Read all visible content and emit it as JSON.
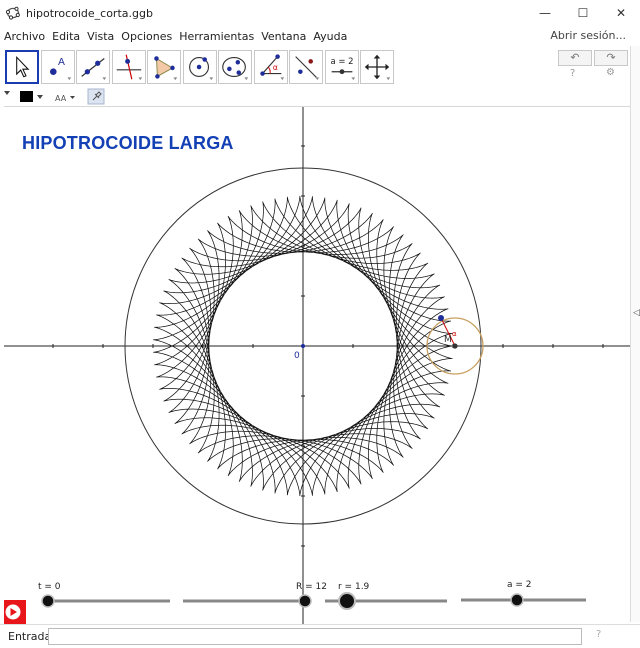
{
  "window": {
    "title": "hipotrocoide_corta.ggb",
    "minimize": "—",
    "maximize": "☐",
    "close": "✕"
  },
  "menu": {
    "items": [
      "Archivo",
      "Edita",
      "Vista",
      "Opciones",
      "Herramientas",
      "Ventana",
      "Ayuda"
    ],
    "login": "Abrir sesión..."
  },
  "toolbar": {
    "undo": "↶",
    "redo": "↷",
    "help": "?",
    "settings": "⚙",
    "slider_tool_label": "a = 2"
  },
  "graphics": {
    "heading": "HIPOTROCOIDE LARGA",
    "origin_label": "0",
    "point_m_label": "M",
    "angle_label": "α"
  },
  "sliders": [
    {
      "label": "t = 0",
      "value": 0,
      "min": 0,
      "max": 1
    },
    {
      "label": "R = 12",
      "value": 12,
      "min": 0,
      "max": 12
    },
    {
      "label": "r = 1.9",
      "value": 1.9,
      "min": 1.9,
      "max": 12
    },
    {
      "label": "a = 2",
      "value": 2,
      "min": 0,
      "max": 4
    }
  ],
  "inputbar": {
    "label": "Entrada:",
    "value": "",
    "help": "?"
  },
  "colors": {
    "heading": "#1340b4",
    "active_tool": "#1a3cb0",
    "play_button": "#e8151b",
    "rolling_circle": "#c8a060"
  }
}
